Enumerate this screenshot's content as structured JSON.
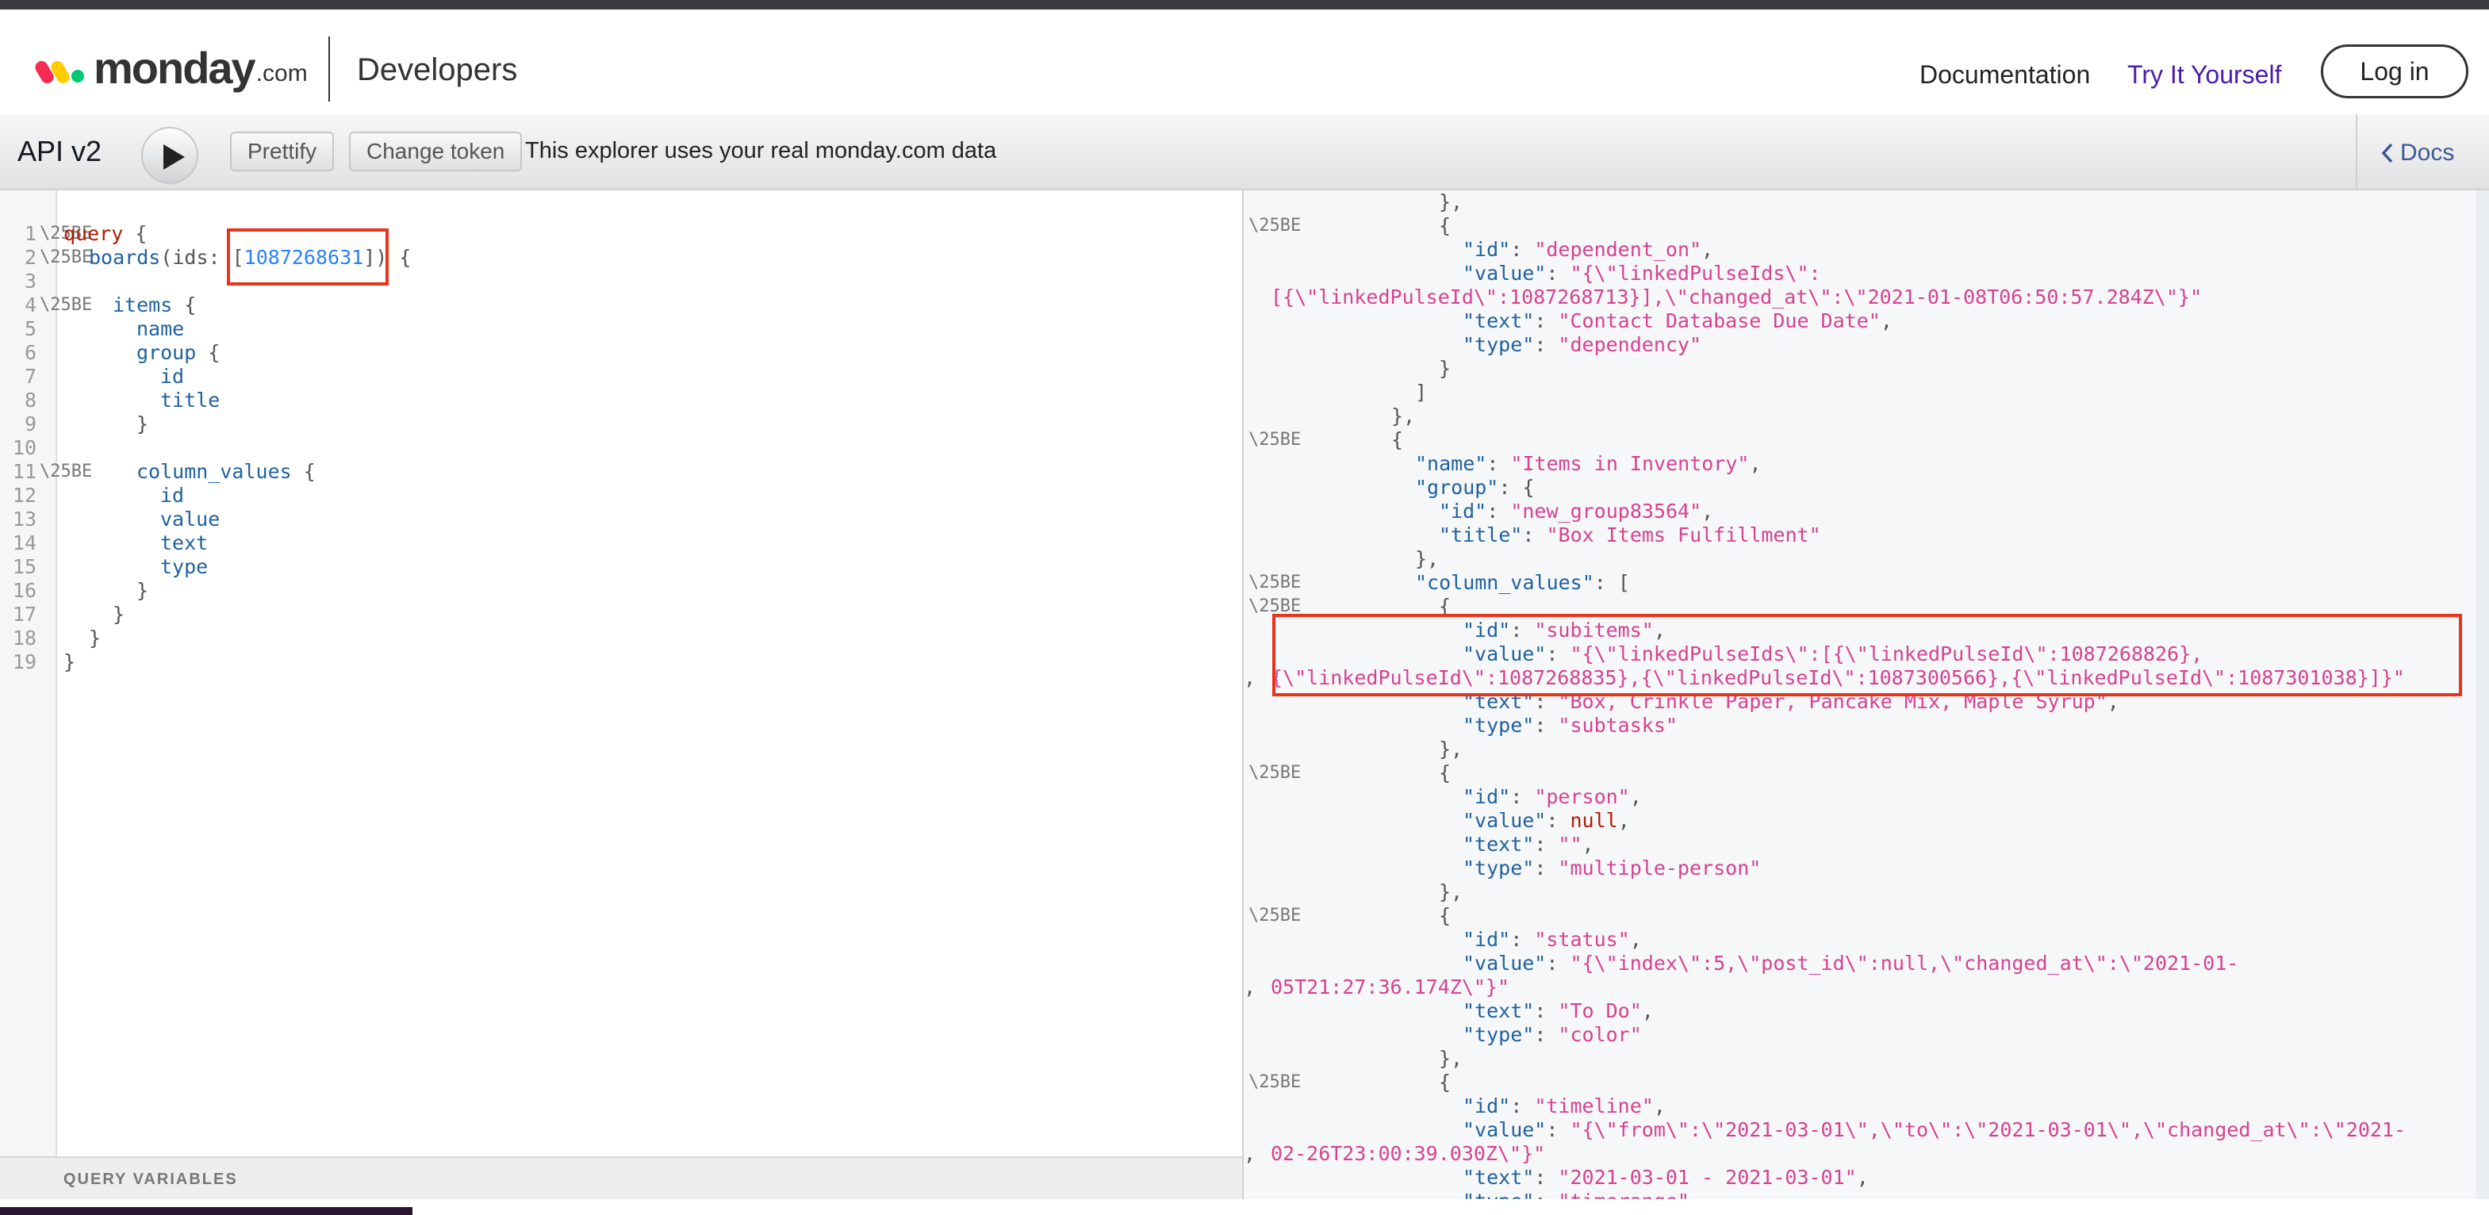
{
  "navbar": {
    "logo_word": "monday",
    "logo_suffix": ".com",
    "section_title": "Developers",
    "links": [
      "Documentation",
      "Try It Yourself"
    ],
    "login_label": "Log in"
  },
  "toolbar": {
    "title": "API v2",
    "prettify_label": "Prettify",
    "change_token_label": "Change token",
    "note": "This explorer uses your real monday.com data",
    "docs_label": "Docs"
  },
  "editor": {
    "fold_marker": "\\25BE",
    "line_numbers": [
      "1",
      "2",
      "3",
      "4",
      "5",
      "6",
      "7",
      "8",
      "9",
      "10",
      "11",
      "12",
      "13",
      "14",
      "15",
      "16",
      "17",
      "18",
      "19"
    ],
    "code": {
      "l1_kw": "query",
      "l1_rest": " {",
      "l2_field": "boards",
      "l2_open": "(ids: [",
      "l2_num": "1087268631",
      "l2_close": "]) {",
      "l4_field": "items",
      "l4_rest": " {",
      "l5": "name",
      "l6_field": "group",
      "l6_rest": " {",
      "l7": "id",
      "l8": "title",
      "l9": "}",
      "l11_field": "column_values",
      "l11_rest": " {",
      "l12": "id",
      "l13": "value",
      "l14": "text",
      "l15": "type",
      "l16": "}",
      "l17": "}",
      "l18": "}",
      "l19": "}"
    },
    "query_variables_label": "QUERY VARIABLES"
  },
  "result": {
    "fold_marker": "\\25BE",
    "lines": {
      "r1": "},",
      "r2": "{",
      "r3_key": "\"id\"",
      "r3_val": "\"dependent_on\"",
      "r4_key": "\"value\"",
      "r4_val": "\"{\\\"linkedPulseIds\\\":",
      "r5_val": "[{\\\"linkedPulseId\\\":1087268713}],\\\"changed_at\\\":\\\"2021-01-08T06:50:57.284Z\\\"}\"",
      "r6_key": "\"text\"",
      "r6_val": "\"Contact Database Due Date\"",
      "r7_key": "\"type\"",
      "r7_val": "\"dependency\"",
      "r8": "}",
      "r9": "]",
      "r10": "},",
      "r11": "{",
      "r12_key": "\"name\"",
      "r12_val": "\"Items in Inventory\"",
      "r13_key": "\"group\"",
      "r14_key": "\"id\"",
      "r14_val": "\"new_group83564\"",
      "r15_key": "\"title\"",
      "r15_val": "\"Box Items Fulfillment\"",
      "r16": "},",
      "r17_key": "\"column_values\"",
      "r18": "{",
      "r19_key": "\"id\"",
      "r19_val": "\"subitems\"",
      "r20_key": "\"value\"",
      "r20_val": "\"{\\\"linkedPulseIds\\\":[{\\\"linkedPulseId\\\":1087268826},",
      "r21_val": "{\\\"linkedPulseId\\\":1087268835},{\\\"linkedPulseId\\\":1087300566},{\\\"linkedPulseId\\\":1087301038}]}\"",
      "r22_key": "\"text\"",
      "r22_val": "\"Box, Crinkle Paper, Pancake Mix, Maple Syrup\"",
      "r23_key": "\"type\"",
      "r23_val": "\"subtasks\"",
      "r24": "},",
      "r25": "{",
      "r26_key": "\"id\"",
      "r26_val": "\"person\"",
      "r27_key": "\"value\"",
      "r27_val": "null",
      "r28_key": "\"text\"",
      "r28_val": "\"\"",
      "r29_key": "\"type\"",
      "r29_val": "\"multiple-person\"",
      "r30": "},",
      "r31": "{",
      "r32_key": "\"id\"",
      "r32_val": "\"status\"",
      "r33_key": "\"value\"",
      "r33_val": "\"{\\\"index\\\":5,\\\"post_id\\\":null,\\\"changed_at\\\":\\\"2021-01-",
      "r34_val": "05T21:27:36.174Z\\\"}\"",
      "r35_key": "\"text\"",
      "r35_val": "\"To Do\"",
      "r36_key": "\"type\"",
      "r36_val": "\"color\"",
      "r37": "},",
      "r38": "{",
      "r39_key": "\"id\"",
      "r39_val": "\"timeline\"",
      "r40_key": "\"value\"",
      "r40_val": "\"{\\\"from\\\":\\\"2021-03-01\\\",\\\"to\\\":\\\"2021-03-01\\\",\\\"changed_at\\\":\\\"2021-",
      "r41_val": "02-26T23:00:39.030Z\\\"}\"",
      "r42_key": "\"text\"",
      "r42_val": "\"2021-03-01 - 2021-03-01\"",
      "r43_key": "\"type\"",
      "r43_val": "\"timerange\""
    }
  },
  "colors": {
    "accent_link": "#4a1bb0",
    "highlight_box": "#e8341c",
    "json_string": "#d64292",
    "graphql_keyword": "#b11a04",
    "graphql_field": "#1f61a0"
  }
}
